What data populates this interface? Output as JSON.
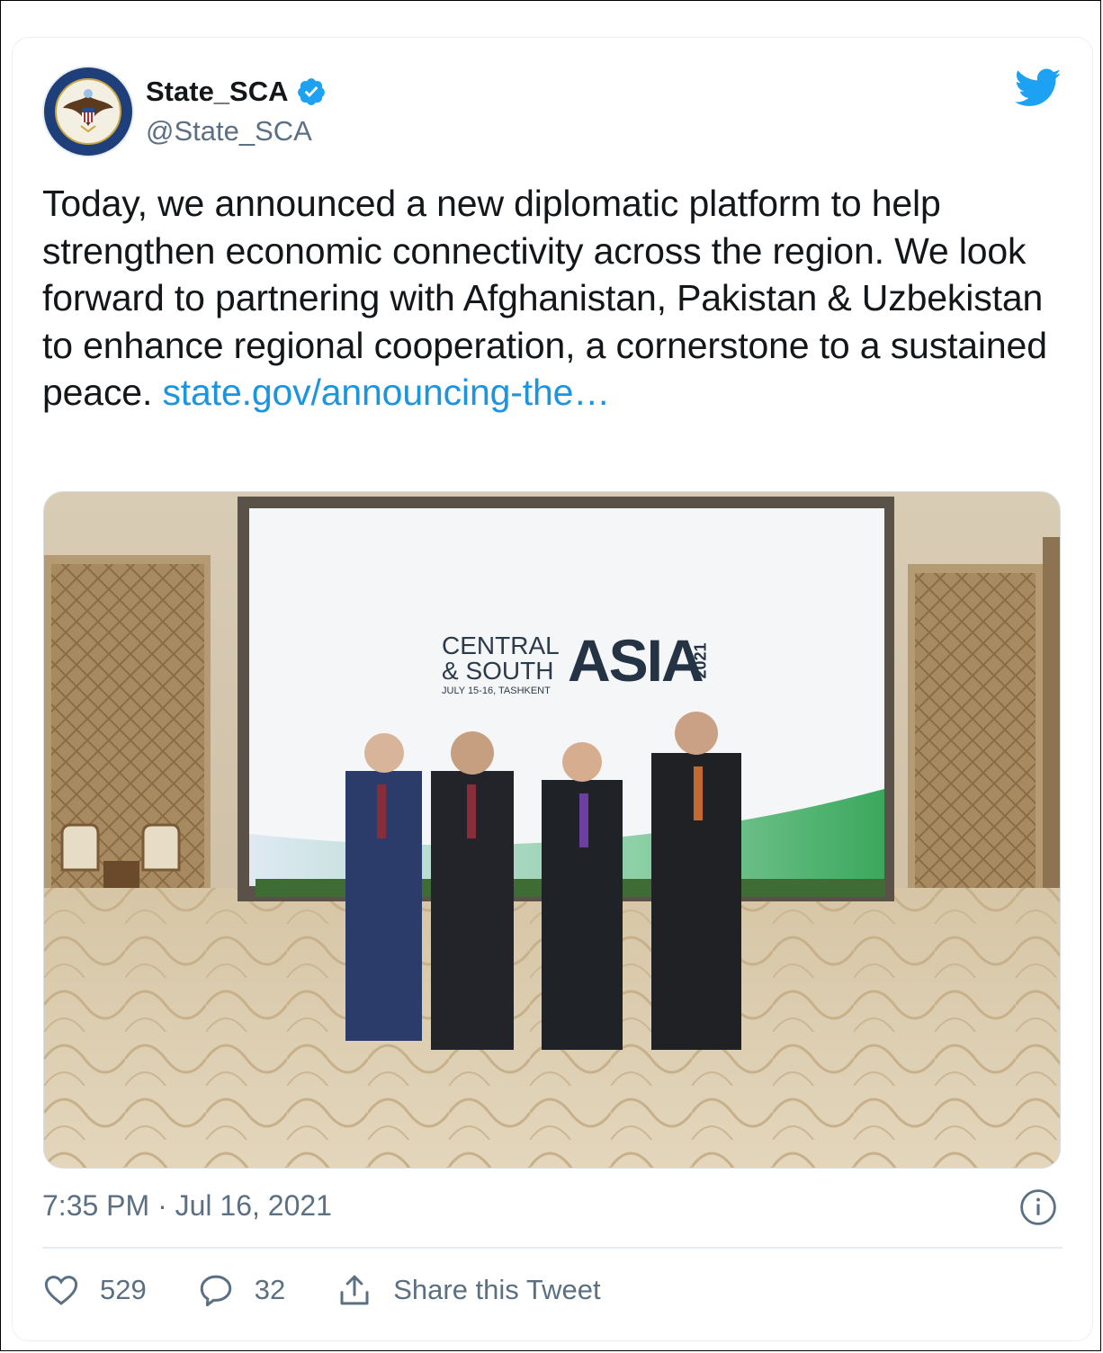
{
  "account": {
    "display_name": "State_SCA",
    "handle": "@State_SCA",
    "avatar": "us-department-of-state-seal",
    "verified_icon": "verified-badge-icon"
  },
  "brand": {
    "icon": "twitter-bird-icon",
    "color": "#1da1f2"
  },
  "tweet": {
    "text": "Today, we announced a new diplomatic platform to help strengthen economic connectivity across the region. We look forward to partnering with Afghanistan, Pakistan & Uzbekistan to enhance regional cooperation, a cornerstone to a sustained peace.",
    "link_text": "state.gov/announcing-the…",
    "link_color": "#1b95e0"
  },
  "photo": {
    "banner_line1": "CENTRAL",
    "banner_line2": "& SOUTH",
    "banner_dates": "JULY 15-16, TASHKENT",
    "banner_big": "ASIA",
    "banner_year": "2021"
  },
  "meta": {
    "timestamp": "7:35 PM · Jul 16, 2021",
    "info_icon": "info-icon"
  },
  "actions": {
    "likes": "529",
    "replies": "32",
    "share_label": "Share this Tweet"
  }
}
